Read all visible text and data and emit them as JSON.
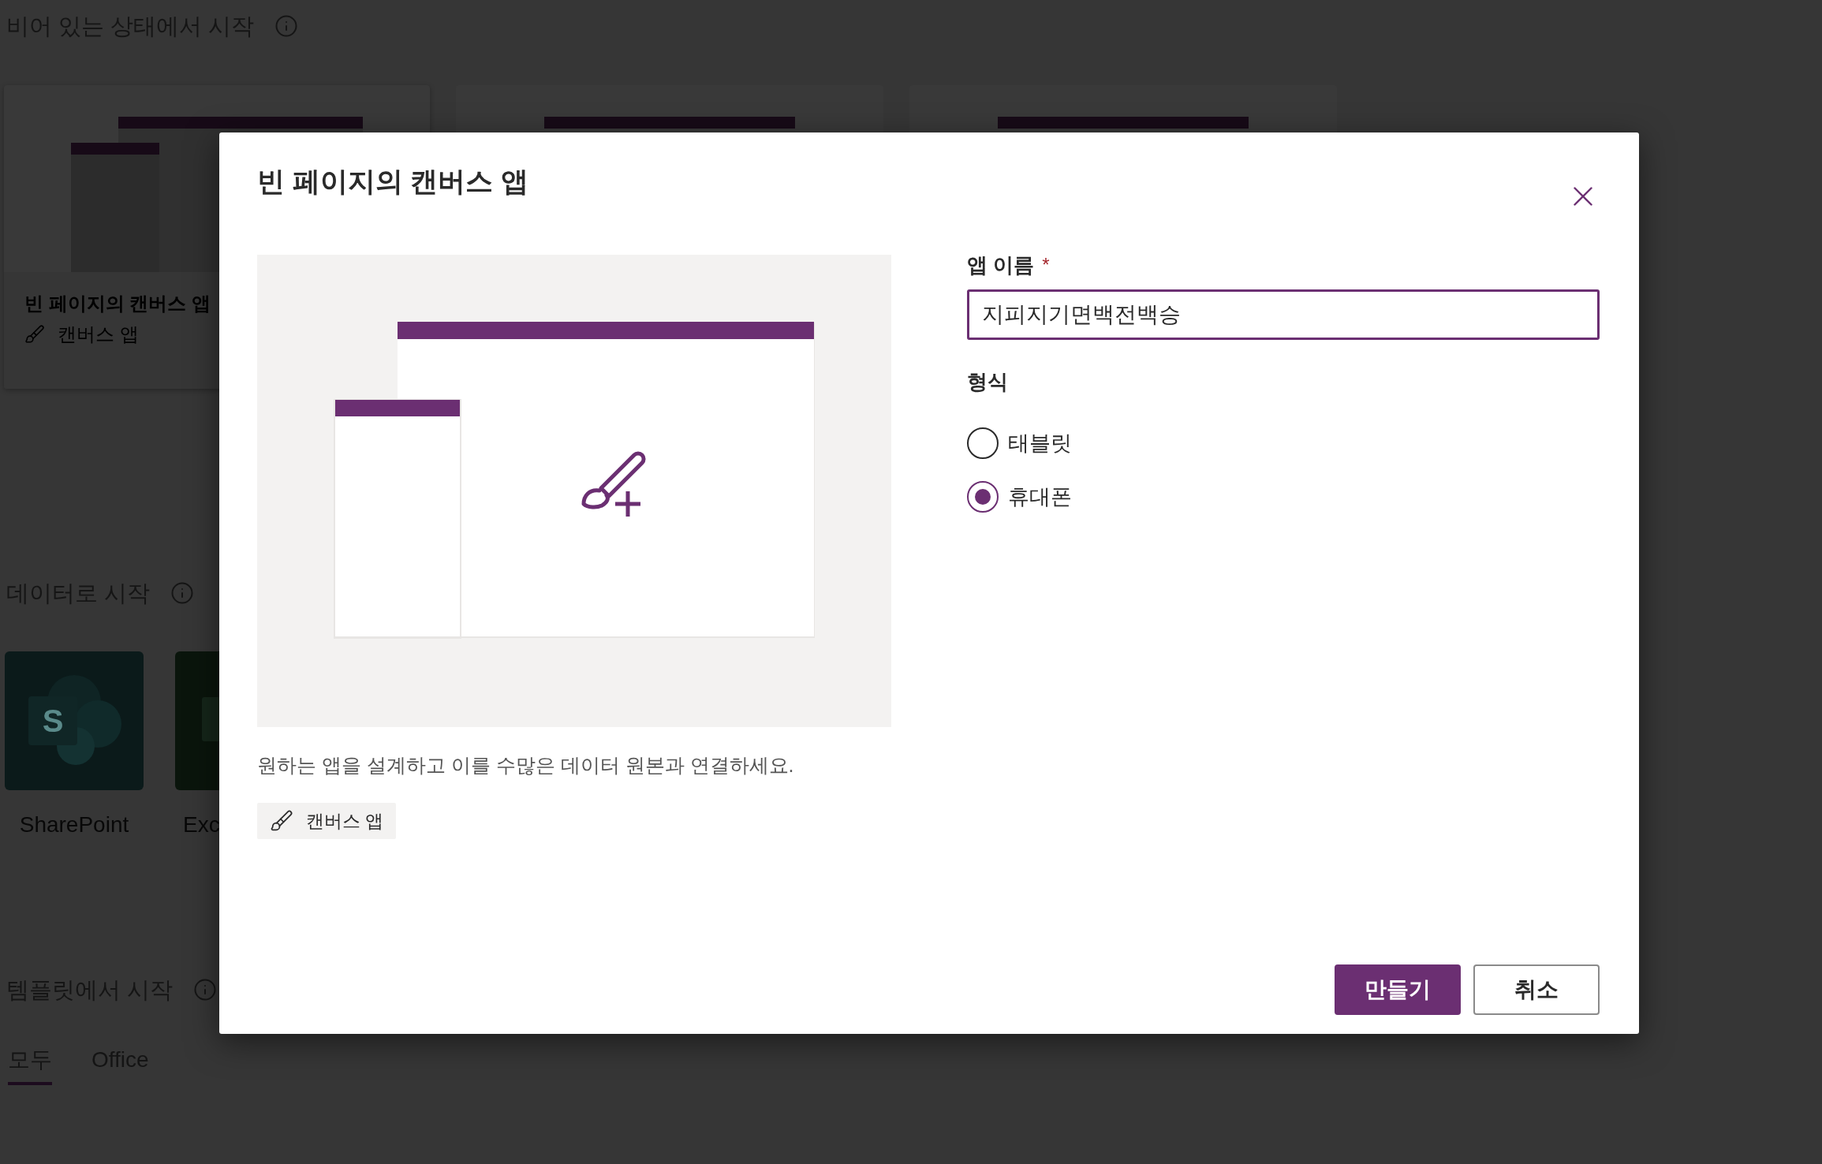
{
  "background": {
    "blank_section": {
      "title": "비어 있는 상태에서 시작",
      "cards": [
        {
          "kind": "canvas",
          "title": "빈 페이지의 캔버스 앱",
          "tag": "캔버스 앱"
        },
        {
          "kind": "wide"
        },
        {
          "kind": "wide"
        }
      ]
    },
    "data_section": {
      "title": "데이터로 시작",
      "sources": [
        {
          "kind": "sharepoint",
          "logo_letter": "S",
          "label": "SharePoint"
        },
        {
          "kind": "excel",
          "label": "Exc"
        }
      ]
    },
    "template_section": {
      "title": "템플릿에서 시작",
      "tabs": [
        {
          "label": "모두",
          "selected": true
        },
        {
          "label": "Office",
          "selected": false
        }
      ]
    }
  },
  "dialog": {
    "title": "빈 페이지의 캔버스 앱",
    "description": "원하는 앱을 설계하고 이를 수많은 데이터 원본과 연결하세요.",
    "tag": "캔버스 앱",
    "name_field": {
      "label": "앱 이름",
      "required_mark": "*",
      "value": "지피지기면백전백승"
    },
    "format": {
      "label": "형식",
      "options": [
        {
          "label": "태블릿",
          "selected": false
        },
        {
          "label": "휴대폰",
          "selected": true
        }
      ]
    },
    "buttons": [
      {
        "kind": "primary",
        "label": "만들기"
      },
      {
        "kind": "secondary",
        "label": "취소"
      }
    ]
  }
}
